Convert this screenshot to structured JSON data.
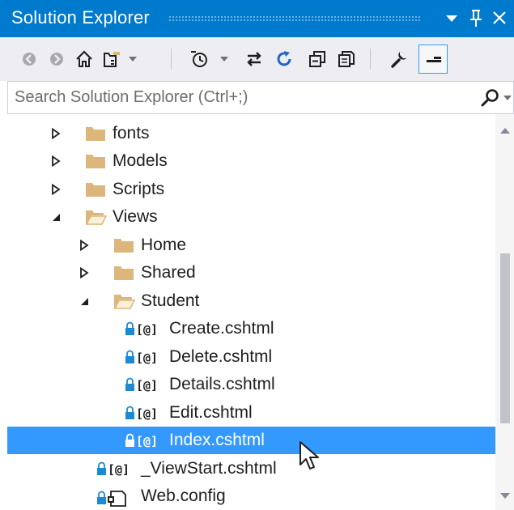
{
  "window": {
    "title": "Solution Explorer",
    "controls": [
      "dropdown-arrow",
      "pin",
      "close"
    ]
  },
  "toolbar": {
    "buttons": [
      {
        "name": "back",
        "icon": "back-icon"
      },
      {
        "name": "forward",
        "icon": "forward-icon"
      },
      {
        "name": "home",
        "icon": "home-icon"
      },
      {
        "name": "switch-views",
        "icon": "switch-views-icon"
      },
      {
        "name": "pending-changes-filter",
        "icon": "clock-filter-icon"
      },
      {
        "name": "sync-with-active-document",
        "icon": "sync-icon"
      },
      {
        "name": "refresh",
        "icon": "refresh-icon"
      },
      {
        "name": "collapse-all",
        "icon": "collapse-all-icon"
      },
      {
        "name": "show-all-files",
        "icon": "show-all-files-icon"
      },
      {
        "name": "properties",
        "icon": "wrench-icon"
      },
      {
        "name": "preview-selected-items",
        "icon": "preview-icon",
        "pressed": true
      }
    ]
  },
  "search": {
    "placeholder": "Search Solution Explorer (Ctrl+;)",
    "value": ""
  },
  "tree": {
    "items": [
      {
        "label": "fonts",
        "type": "folder",
        "expanded": false
      },
      {
        "label": "Models",
        "type": "folder",
        "expanded": false
      },
      {
        "label": "Scripts",
        "type": "folder",
        "expanded": false
      },
      {
        "label": "Views",
        "type": "folder",
        "expanded": true
      },
      {
        "label": "Home",
        "type": "folder",
        "expanded": false
      },
      {
        "label": "Shared",
        "type": "folder",
        "expanded": false
      },
      {
        "label": "Student",
        "type": "folder",
        "expanded": true
      },
      {
        "label": "Create.cshtml",
        "type": "razor-file",
        "locked": true
      },
      {
        "label": "Delete.cshtml",
        "type": "razor-file",
        "locked": true
      },
      {
        "label": "Details.cshtml",
        "type": "razor-file",
        "locked": true
      },
      {
        "label": "Edit.cshtml",
        "type": "razor-file",
        "locked": true
      },
      {
        "label": "Index.cshtml",
        "type": "razor-file",
        "locked": true,
        "selected": true
      },
      {
        "label": "_ViewStart.cshtml",
        "type": "razor-file",
        "locked": true
      },
      {
        "label": "Web.config",
        "type": "config-file",
        "locked": true
      }
    ]
  },
  "colors": {
    "titlebar": "#007acc",
    "selection": "#3399ff",
    "folder": "#dcb67a",
    "lock": "#1b8ad3"
  }
}
